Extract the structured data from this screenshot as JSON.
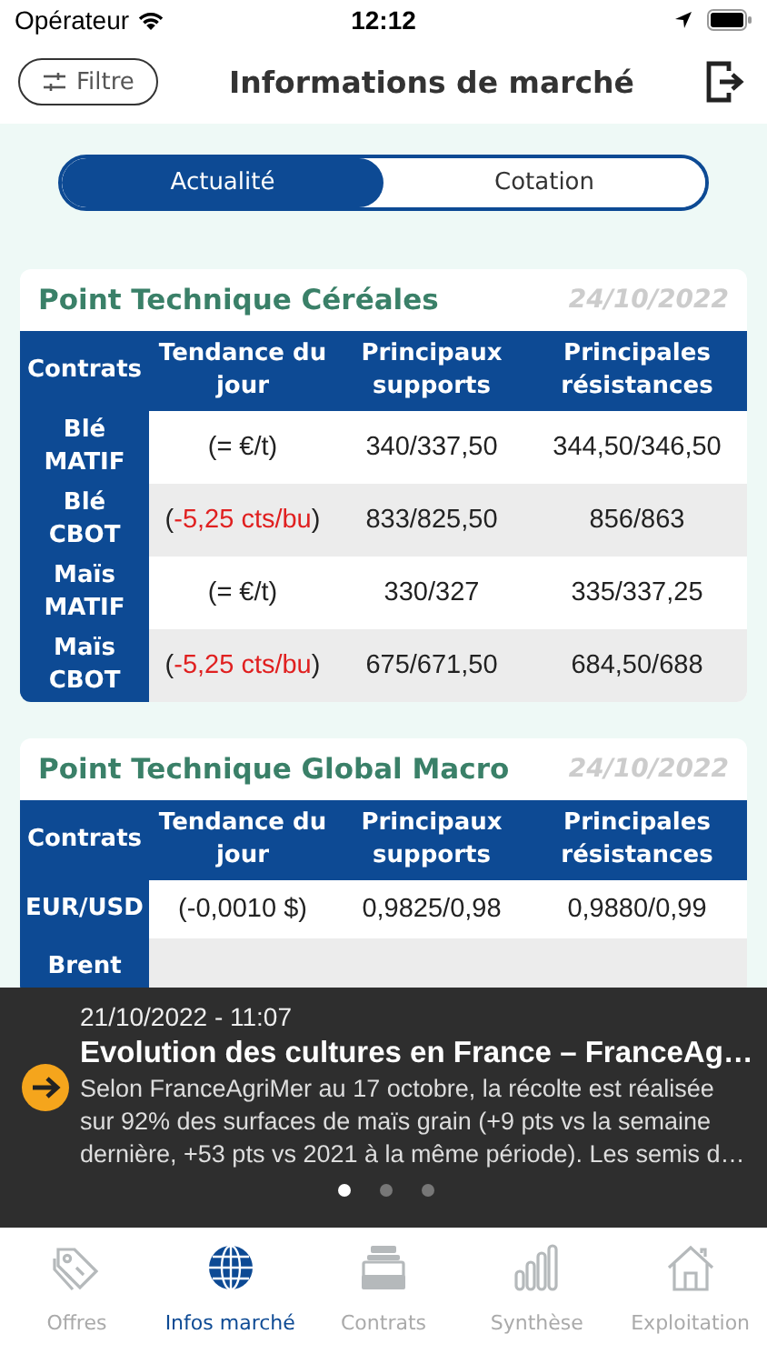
{
  "status_bar": {
    "carrier": "Opérateur",
    "time": "12:12"
  },
  "header": {
    "filter_button": "Filtre",
    "title": "Informations de marché"
  },
  "segments": [
    {
      "label": "Actualité",
      "selected": true
    },
    {
      "label": "Cotation",
      "selected": false
    }
  ],
  "cards": [
    {
      "title": "Point Technique Céréales",
      "date": "24/10/2022",
      "columns": [
        "Contrats",
        "Tendance du jour",
        "Principaux supports",
        "Principales résistances"
      ],
      "rows": [
        {
          "contract": "Blé MATIF",
          "trend": "(= €/t)",
          "kind": "flat",
          "supports": "340/337,50",
          "resistances": "344,50/346,50"
        },
        {
          "contract": "Blé CBOT",
          "trend": "(-5,25 cts/bu)",
          "kind": "down",
          "supports": "833/825,50",
          "resistances": "856/863"
        },
        {
          "contract": "Maïs MATIF",
          "trend": "(= €/t)",
          "kind": "flat",
          "supports": "330/327",
          "resistances": "335/337,25"
        },
        {
          "contract": "Maïs CBOT",
          "trend": "(-5,25 cts/bu)",
          "kind": "down",
          "supports": "675/671,50",
          "resistances": "684,50/688"
        }
      ]
    },
    {
      "title": "Point Technique Global Macro",
      "date": "24/10/2022",
      "columns": [
        "Contrats",
        "Tendance du jour",
        "Principaux supports",
        "Principales résistances"
      ],
      "rows": [
        {
          "contract": "EUR/USD",
          "trend": "(-0,0010 $)",
          "kind": "flat",
          "supports": "0,9825/0,98",
          "resistances": "0,9880/0,99"
        },
        {
          "contract": "Brent"
        }
      ]
    }
  ],
  "news": {
    "date": "21/10/2022 - 11:07",
    "title": "Evolution des cultures en France – FranceAg…",
    "body": "Selon FranceAgriMer au 17 octobre, la récolte est réalisée sur 92% des surfaces de maïs grain (+9 pts vs la semaine dernière, +53 pts vs 2021 à la même période). Les semis d…",
    "pages": [
      {
        "selected": true
      },
      {
        "selected": false
      },
      {
        "selected": false
      }
    ]
  },
  "tab_bar": [
    {
      "label": "Offres",
      "kind": "tag",
      "selected": false
    },
    {
      "label": "Infos marché",
      "kind": "globe",
      "selected": true
    },
    {
      "label": "Contrats",
      "kind": "tray",
      "selected": false
    },
    {
      "label": "Synthèse",
      "kind": "bars",
      "selected": false
    },
    {
      "label": "Exploitation",
      "kind": "house",
      "selected": false
    }
  ]
}
